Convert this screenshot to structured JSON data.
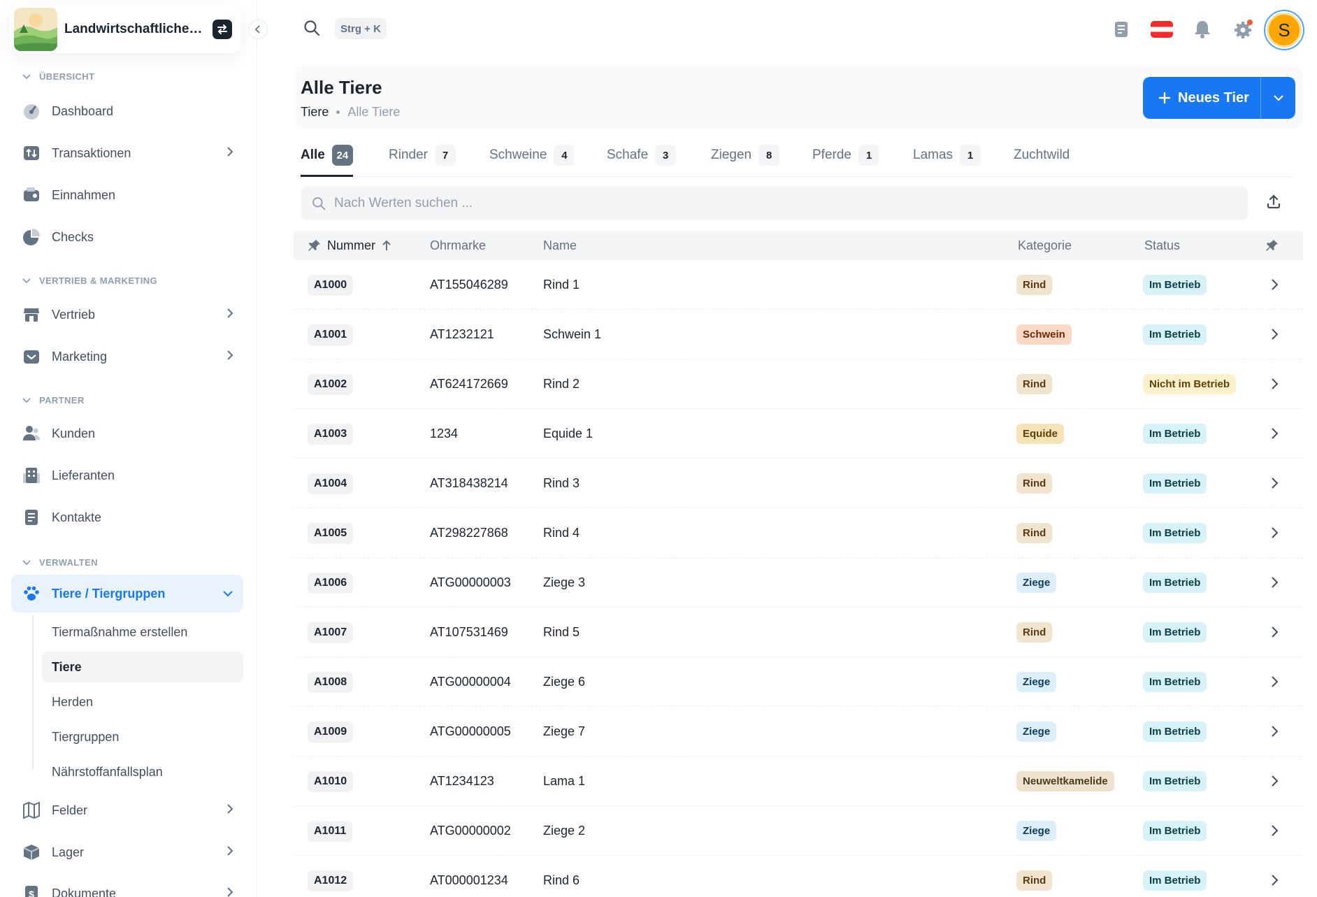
{
  "org": {
    "name": "Landwirtschaftlicher Betrieb"
  },
  "topbar": {
    "shortcut": "Strg + K",
    "avatar_letter": "S"
  },
  "sidebar": {
    "sections": [
      {
        "label": "ÜBERSICHT"
      },
      {
        "label": "VERTRIEB & MARKETING"
      },
      {
        "label": "PARTNER"
      },
      {
        "label": "VERWALTEN"
      }
    ],
    "items": [
      {
        "label": "Dashboard",
        "icon": "dashboard-icon"
      },
      {
        "label": "Transaktionen",
        "icon": "transactions-icon"
      },
      {
        "label": "Einnahmen",
        "icon": "wallet-icon"
      },
      {
        "label": "Checks",
        "icon": "pie-chart-icon"
      },
      {
        "label": "Vertrieb",
        "icon": "store-icon"
      },
      {
        "label": "Marketing",
        "icon": "inbox-icon"
      },
      {
        "label": "Kunden",
        "icon": "users-icon"
      },
      {
        "label": "Lieferanten",
        "icon": "building-icon"
      },
      {
        "label": "Kontakte",
        "icon": "contacts-icon"
      },
      {
        "label": "Tiere / Tiergruppen",
        "icon": "paw-icon"
      },
      {
        "label": "Felder",
        "icon": "map-icon"
      },
      {
        "label": "Lager",
        "icon": "box-icon"
      },
      {
        "label": "Dokumente",
        "icon": "document-icon"
      }
    ],
    "subitems": [
      {
        "label": "Tiermaßnahme erstellen"
      },
      {
        "label": "Tiere"
      },
      {
        "label": "Herden"
      },
      {
        "label": "Tiergruppen"
      },
      {
        "label": "Nährstoffanfallsplan"
      }
    ]
  },
  "page": {
    "title": "Alle Tiere",
    "breadcrumb": [
      "Tiere",
      "Alle Tiere"
    ],
    "new_button": "Neues Tier"
  },
  "tabs": [
    {
      "label": "Alle",
      "count": "24"
    },
    {
      "label": "Rinder",
      "count": "7"
    },
    {
      "label": "Schweine",
      "count": "4"
    },
    {
      "label": "Schafe",
      "count": "3"
    },
    {
      "label": "Ziegen",
      "count": "8"
    },
    {
      "label": "Pferde",
      "count": "1"
    },
    {
      "label": "Lamas",
      "count": "1"
    },
    {
      "label": "Zuchtwild",
      "count": ""
    }
  ],
  "search": {
    "placeholder": "Nach Werten suchen ..."
  },
  "table": {
    "columns": [
      "Nummer",
      "Ohrmarke",
      "Name",
      "Kategorie",
      "Status"
    ],
    "rows": [
      {
        "nummer": "A1000",
        "ohrmarke": "AT155046289",
        "name": "Rind 1",
        "kategorie": "Rind",
        "status": "Im Betrieb"
      },
      {
        "nummer": "A1001",
        "ohrmarke": "AT1232121",
        "name": "Schwein 1",
        "kategorie": "Schwein",
        "status": "Im Betrieb"
      },
      {
        "nummer": "A1002",
        "ohrmarke": "AT624172669",
        "name": "Rind 2",
        "kategorie": "Rind",
        "status": "Nicht im Betrieb"
      },
      {
        "nummer": "A1003",
        "ohrmarke": "1234",
        "name": "Equide 1",
        "kategorie": "Equide",
        "status": "Im Betrieb"
      },
      {
        "nummer": "A1004",
        "ohrmarke": "AT318438214",
        "name": "Rind 3",
        "kategorie": "Rind",
        "status": "Im Betrieb"
      },
      {
        "nummer": "A1005",
        "ohrmarke": "AT298227868",
        "name": "Rind 4",
        "kategorie": "Rind",
        "status": "Im Betrieb"
      },
      {
        "nummer": "A1006",
        "ohrmarke": "ATG00000003",
        "name": "Ziege 3",
        "kategorie": "Ziege",
        "status": "Im Betrieb"
      },
      {
        "nummer": "A1007",
        "ohrmarke": "AT107531469",
        "name": "Rind 5",
        "kategorie": "Rind",
        "status": "Im Betrieb"
      },
      {
        "nummer": "A1008",
        "ohrmarke": "ATG00000004",
        "name": "Ziege 6",
        "kategorie": "Ziege",
        "status": "Im Betrieb"
      },
      {
        "nummer": "A1009",
        "ohrmarke": "ATG00000005",
        "name": "Ziege 7",
        "kategorie": "Ziege",
        "status": "Im Betrieb"
      },
      {
        "nummer": "A1010",
        "ohrmarke": "AT1234123",
        "name": "Lama 1",
        "kategorie": "Neuweltkamelide",
        "status": "Im Betrieb"
      },
      {
        "nummer": "A1011",
        "ohrmarke": "ATG00000002",
        "name": "Ziege 2",
        "kategorie": "Ziege",
        "status": "Im Betrieb"
      },
      {
        "nummer": "A1012",
        "ohrmarke": "AT000001234",
        "name": "Rind 6",
        "kategorie": "Rind",
        "status": "Im Betrieb"
      }
    ]
  },
  "colors": {
    "primary": "#1877f2",
    "tag_rind_bg": "#f1e4cf",
    "tag_rind_fg": "#5c3b12",
    "tag_schwein_bg": "#fbd9c5",
    "tag_schwein_fg": "#6b2a0a",
    "tag_equide_bg": "#f5e3b8",
    "tag_equide_fg": "#5c4308",
    "tag_ziege_bg": "#dceefa",
    "tag_ziege_fg": "#0c3b5e",
    "tag_lama_bg": "#eee2cf",
    "tag_lama_fg": "#4c3b22",
    "status_active_bg": "#d7f3f7",
    "status_active_fg": "#0b3f46",
    "status_inactive_bg": "#fdf0cc",
    "status_inactive_fg": "#5c4308"
  }
}
